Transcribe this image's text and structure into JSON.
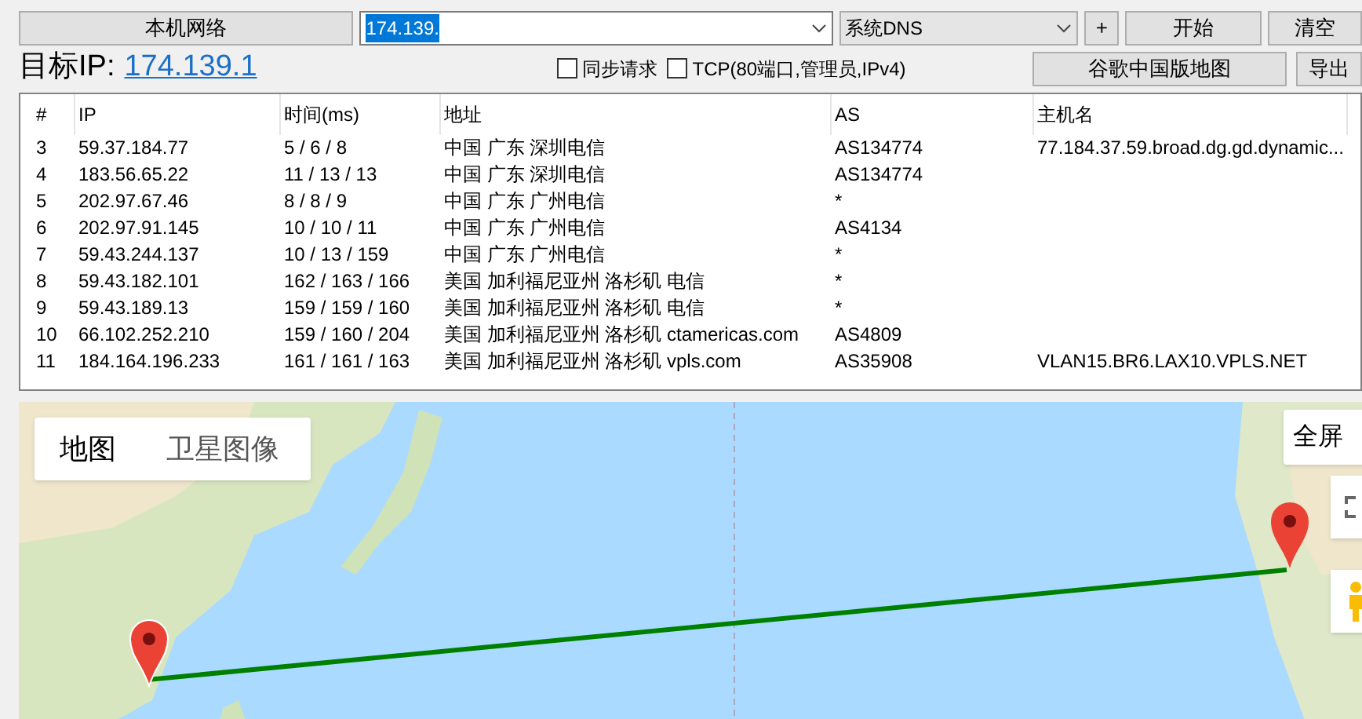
{
  "toolbar": {
    "network_button": "本机网络",
    "target_combo": {
      "value": "174.139.",
      "selected": true
    },
    "dns_combo": {
      "value": "系统DNS"
    },
    "add_button": "+",
    "start_button": "开始",
    "clear_button": "清空"
  },
  "target": {
    "label": "目标IP:",
    "ip_link": "174.139.1"
  },
  "options": [
    {
      "label": "同步请求",
      "checked": false
    },
    {
      "label": "TCP(80端口,管理员,IPv4)",
      "checked": false
    }
  ],
  "map_button": "谷歌中国版地图",
  "export_button": "导出",
  "table": {
    "columns": [
      "#",
      "IP",
      "时间(ms)",
      "地址",
      "AS",
      "主机名"
    ],
    "rows": [
      [
        "3",
        "59.37.184.77",
        "5 / 6 / 8",
        "中国 广东 深圳电信",
        "AS134774",
        "77.184.37.59.broad.dg.gd.dynamic..."
      ],
      [
        "4",
        "183.56.65.22",
        "11 / 13 / 13",
        "中国 广东 深圳电信",
        "AS134774",
        ""
      ],
      [
        "5",
        "202.97.67.46",
        "8 / 8 / 9",
        "中国 广东 广州电信",
        "*",
        ""
      ],
      [
        "6",
        "202.97.91.145",
        "10 / 10 / 11",
        "中国 广东 广州电信",
        "AS4134",
        ""
      ],
      [
        "7",
        "59.43.244.137",
        "10 / 13 / 159",
        "中国 广东 广州电信",
        "*",
        ""
      ],
      [
        "8",
        "59.43.182.101",
        "162 / 163 / 166",
        "美国 加利福尼亚州 洛杉矶 电信",
        "*",
        ""
      ],
      [
        "9",
        "59.43.189.13",
        "159 / 159 / 160",
        "美国 加利福尼亚州 洛杉矶 电信",
        "*",
        ""
      ],
      [
        "10",
        "66.102.252.210",
        "159 / 160 / 204",
        "美国 加利福尼亚州 洛杉矶 ctamericas.com",
        "AS4809",
        ""
      ],
      [
        "11",
        "184.164.196.233",
        "161 / 161 / 163",
        "美国 加利福尼亚州 洛杉矶 vpls.com",
        "AS35908",
        "VLAN15.BR6.LAX10.VPLS.NET"
      ]
    ]
  },
  "map": {
    "map_types": [
      {
        "label": "地图",
        "selected": true
      },
      {
        "label": "卫星图像",
        "selected": false
      }
    ],
    "fullscreen_label": "全屏"
  }
}
